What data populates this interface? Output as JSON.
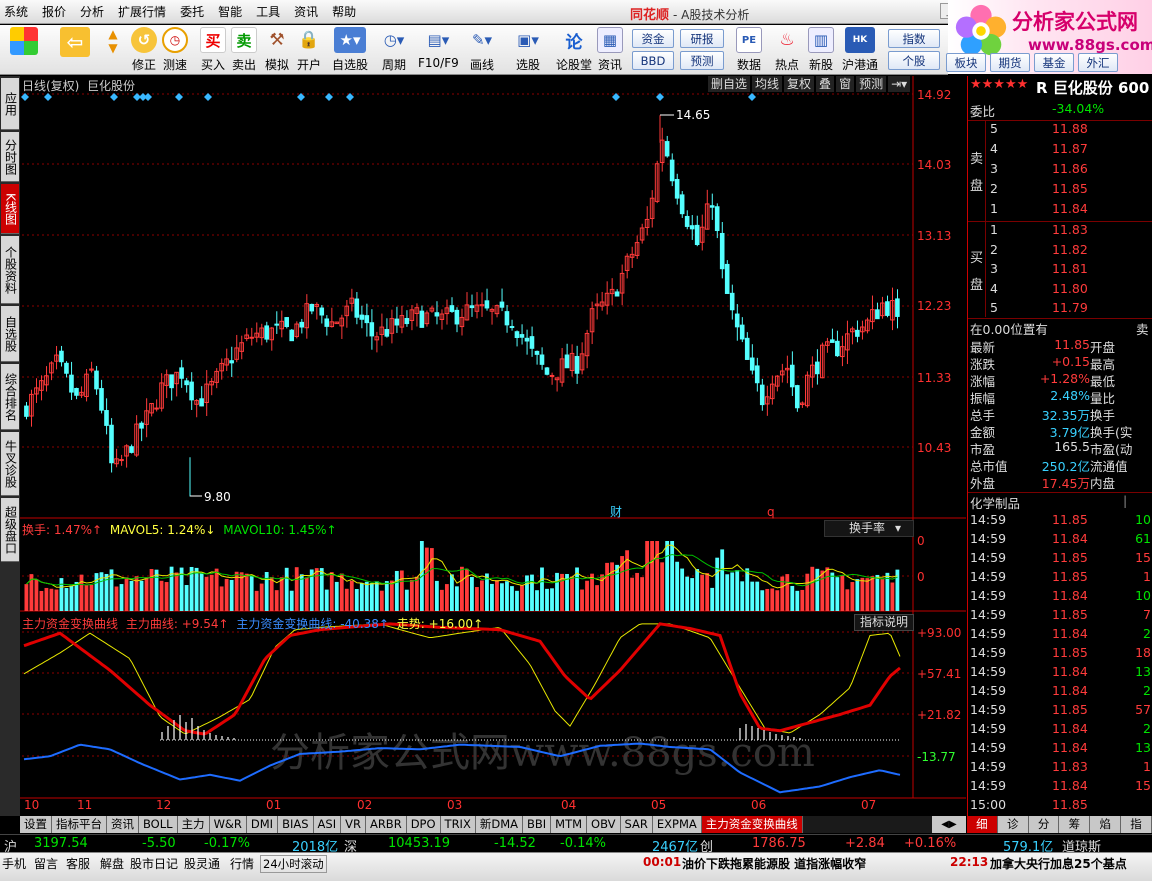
{
  "menu": [
    "系统",
    "报价",
    "分析",
    "扩展行情",
    "委托",
    "智能",
    "工具",
    "资讯",
    "帮助"
  ],
  "app": {
    "name": "同花顺",
    "title": "- A股技术分析"
  },
  "logo": {
    "text": "分析家公式网",
    "url": "www.88gs.com"
  },
  "toolbar": {
    "buttons": [
      "修正",
      "测速",
      "买入",
      "卖出",
      "模拟",
      "开户",
      "自选股",
      "周期",
      "F10/F9",
      "画线",
      "选股",
      "论股堂",
      "资讯",
      "数据",
      "热点",
      "新股",
      "沪港通"
    ],
    "small": [
      "资金",
      "研报",
      "BBD",
      "预测",
      "指数",
      "个股",
      "板块",
      "期货",
      "基金",
      "外汇"
    ]
  },
  "left_tabs": [
    "应用",
    "分时图",
    "K线图",
    "个股资料",
    "自选股",
    "综合排名",
    "牛叉诊股",
    "超级盘口"
  ],
  "chart": {
    "header": "日线(复权)  巨化股份",
    "header_btns": [
      "删自选",
      "均线",
      "复权",
      "叠",
      "窗",
      "预测"
    ],
    "price_ticks": [
      "14.92",
      "14.03",
      "13.13",
      "12.23",
      "11.33",
      "10.43"
    ],
    "high_label": "14.65",
    "low_label": "9.80",
    "markers": [
      "财",
      "q"
    ],
    "vol_legend": {
      "a": "换手: 1.47%↑",
      "b": "MAVOL5: 1.24%↓",
      "c": "MAVOL10: 1.45%↑"
    },
    "vol_sel": "换手率",
    "vol_ticks": [
      "0",
      "0"
    ],
    "ind_legend": {
      "a": "主力资金变换曲线",
      "b": "主力曲线: +9.54↑",
      "c": "主力资金变换曲线: -40.38↑",
      "d": "走势: +16.00↑"
    },
    "ind_btn": "指标说明",
    "ind_ticks": [
      "+93.00",
      "+57.41",
      "+21.82",
      "-13.77"
    ],
    "months": [
      "10",
      "11",
      "12",
      "01",
      "02",
      "03",
      "04",
      "05",
      "06",
      "07"
    ],
    "watermark": "分析家公式网www.88gs.com"
  },
  "chart_data": {
    "type": "candlestick",
    "title": "日线(复权) 巨化股份",
    "ylim": [
      9.6,
      14.92
    ],
    "price_high": 14.65,
    "price_low": 9.8,
    "months": [
      "10",
      "11",
      "12",
      "01",
      "02",
      "03",
      "04",
      "05",
      "06",
      "07"
    ]
  },
  "quote": {
    "title": "R 巨化股份 600",
    "weibi_label": "委比",
    "weibi": "-34.04%",
    "sell_label": [
      "卖",
      "盘"
    ],
    "buy_label": [
      "买",
      "盘"
    ],
    "sell": [
      [
        "5",
        "11.88"
      ],
      [
        "4",
        "11.87"
      ],
      [
        "3",
        "11.86"
      ],
      [
        "2",
        "11.85"
      ],
      [
        "1",
        "11.84"
      ]
    ],
    "buy": [
      [
        "1",
        "11.83"
      ],
      [
        "2",
        "11.82"
      ],
      [
        "3",
        "11.81"
      ],
      [
        "4",
        "11.80"
      ],
      [
        "5",
        "11.79"
      ]
    ],
    "pos_label": "在0.00位置有",
    "pos_right": "卖",
    "stats": [
      [
        "最新",
        "11.85",
        "开盘"
      ],
      [
        "涨跌",
        "+0.15",
        "最高"
      ],
      [
        "涨幅",
        "+1.28%",
        "最低"
      ],
      [
        "振幅",
        "2.48%",
        "量比"
      ],
      [
        "总手",
        "32.35万",
        "换手"
      ],
      [
        "金额",
        "3.79亿",
        "换手(实"
      ],
      [
        "市盈",
        "165.5",
        "市盈(动"
      ],
      [
        "总市值",
        "250.2亿",
        "流通值"
      ],
      [
        "外盘",
        "17.45万",
        "内盘"
      ]
    ],
    "industry": "化学制品",
    "ticks": [
      [
        "14:59",
        "11.85",
        "10"
      ],
      [
        "14:59",
        "11.84",
        "61"
      ],
      [
        "14:59",
        "11.85",
        "15"
      ],
      [
        "14:59",
        "11.85",
        "1"
      ],
      [
        "14:59",
        "11.84",
        "10"
      ],
      [
        "14:59",
        "11.85",
        "7"
      ],
      [
        "14:59",
        "11.84",
        "2"
      ],
      [
        "14:59",
        "11.85",
        "18"
      ],
      [
        "14:59",
        "11.84",
        "13"
      ],
      [
        "14:59",
        "11.84",
        "2"
      ],
      [
        "14:59",
        "11.85",
        "57"
      ],
      [
        "14:59",
        "11.84",
        "2"
      ],
      [
        "14:59",
        "11.84",
        "13"
      ],
      [
        "14:59",
        "11.83",
        "1"
      ],
      [
        "14:59",
        "11.84",
        "15"
      ],
      [
        "15:00",
        "11.85",
        ""
      ]
    ]
  },
  "tabs": [
    "设置",
    "指标平台",
    "资讯",
    "BOLL",
    "主力",
    "W&R",
    "DMI",
    "BIAS",
    "ASI",
    "VR",
    "ARBR",
    "DPO",
    "TRIX",
    "新DMA",
    "BBI",
    "MTM",
    "OBV",
    "SAR",
    "EXPMA",
    "主力资金变换曲线"
  ],
  "right_tabs": [
    "细",
    "诊",
    "分",
    "筹",
    "焰",
    "指"
  ],
  "index": {
    "sh_label": "沪",
    "sh_val": "3197.54",
    "sh_chg": "-5.50",
    "sh_pct": "-0.17%",
    "sh_amt": "2018亿",
    "sz_label": "深",
    "sz_val": "10453.19",
    "sz_chg": "-14.52",
    "sz_pct": "-0.14%",
    "sz_amt": "2467亿",
    "cy_label": "创",
    "cy_val": "1786.75",
    "cy_chg": "+2.84",
    "cy_pct": "+0.16%",
    "cy_amt": "579.1亿",
    "dj_label": "道琼斯"
  },
  "bottom": {
    "items": [
      "手机",
      "留言",
      "客服",
      "解盘",
      "股市日记",
      "股灵通",
      "行情",
      "24小时滚动"
    ],
    "news1_time": "00:01",
    "news1": "油价下跌拖累能源股 道指涨幅收窄",
    "news2_time": "22:13",
    "news2": "加拿大央行加息25个基点"
  },
  "colors": {
    "up": "#ff3a3a",
    "down": "#54ffff",
    "ma_red": "#e00000",
    "ma_yellow": "#e8e800",
    "blue": "#1e6cff",
    "grid": "#8b0000"
  }
}
